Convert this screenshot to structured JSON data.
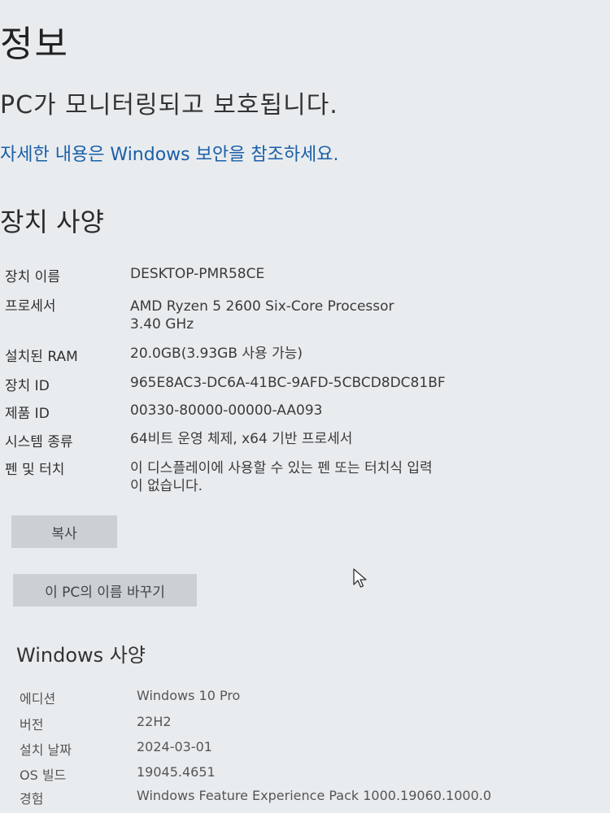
{
  "header": {
    "title": "정보",
    "protection_status": "PC가 모니터링되고 보호됩니다.",
    "security_link": "자세한 내용은 Windows 보안을 참조하세요."
  },
  "device_specs": {
    "heading": "장치 사양",
    "rows": [
      {
        "label": "장치 이름",
        "value": "DESKTOP-PMR58CE"
      },
      {
        "label": "프로세서",
        "value": "AMD Ryzen 5 2600 Six-Core Processor\n3.40 GHz"
      },
      {
        "label": "설치된 RAM",
        "value": "20.0GB(3.93GB 사용 가능)"
      },
      {
        "label": "장치 ID",
        "value": "965E8AC3-DC6A-41BC-9AFD-5CBCD8DC81BF"
      },
      {
        "label": "제품 ID",
        "value": "00330-80000-00000-AA093"
      },
      {
        "label": "시스템 종류",
        "value": "64비트 운영 체제, x64 기반 프로세서"
      },
      {
        "label": "펜 및 터치",
        "value": "이 디스플레이에 사용할 수 있는 펜 또는 터치식 입력\n이 없습니다."
      }
    ],
    "copy_button": "복사",
    "rename_button": "이 PC의 이름 바꾸기"
  },
  "windows_specs": {
    "heading": "Windows 사양",
    "rows": [
      {
        "label": "에디션",
        "value": "Windows 10 Pro"
      },
      {
        "label": "버전",
        "value": "22H2"
      },
      {
        "label": "설치 날짜",
        "value": "2024-03-01"
      },
      {
        "label": "OS 빌드",
        "value": "19045.4651"
      },
      {
        "label": "경험",
        "value": "Windows Feature Experience Pack 1000.19060.1000.0"
      }
    ]
  },
  "icons": {
    "cursor": "mouse-pointer-icon"
  },
  "colors": {
    "background": "#e9ecef",
    "link": "#1a5fa8",
    "button": "#cbd0d4"
  }
}
